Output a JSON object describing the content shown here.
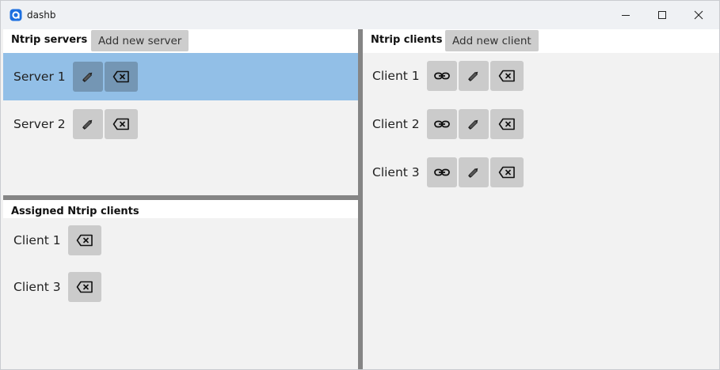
{
  "window": {
    "title": "dashb"
  },
  "servers": {
    "title": "Ntrip servers",
    "add_label": "Add new server",
    "items": [
      {
        "label": "Server 1",
        "selected": true
      },
      {
        "label": "Server 2",
        "selected": false
      }
    ]
  },
  "assigned": {
    "title": "Assigned Ntrip clients",
    "items": [
      {
        "label": "Client 1"
      },
      {
        "label": "Client 3"
      }
    ]
  },
  "clients": {
    "title": "Ntrip clients",
    "add_label": "Add new client",
    "items": [
      {
        "label": "Client 1"
      },
      {
        "label": "Client 2"
      },
      {
        "label": "Client 3"
      }
    ]
  },
  "colors": {
    "selected_row": "#92bfe7",
    "button": "#cbcbcb",
    "splitter": "#858585"
  },
  "icons": {
    "edit": "pencil-icon",
    "delete": "backspace-x-icon",
    "link": "chain-link-icon"
  }
}
